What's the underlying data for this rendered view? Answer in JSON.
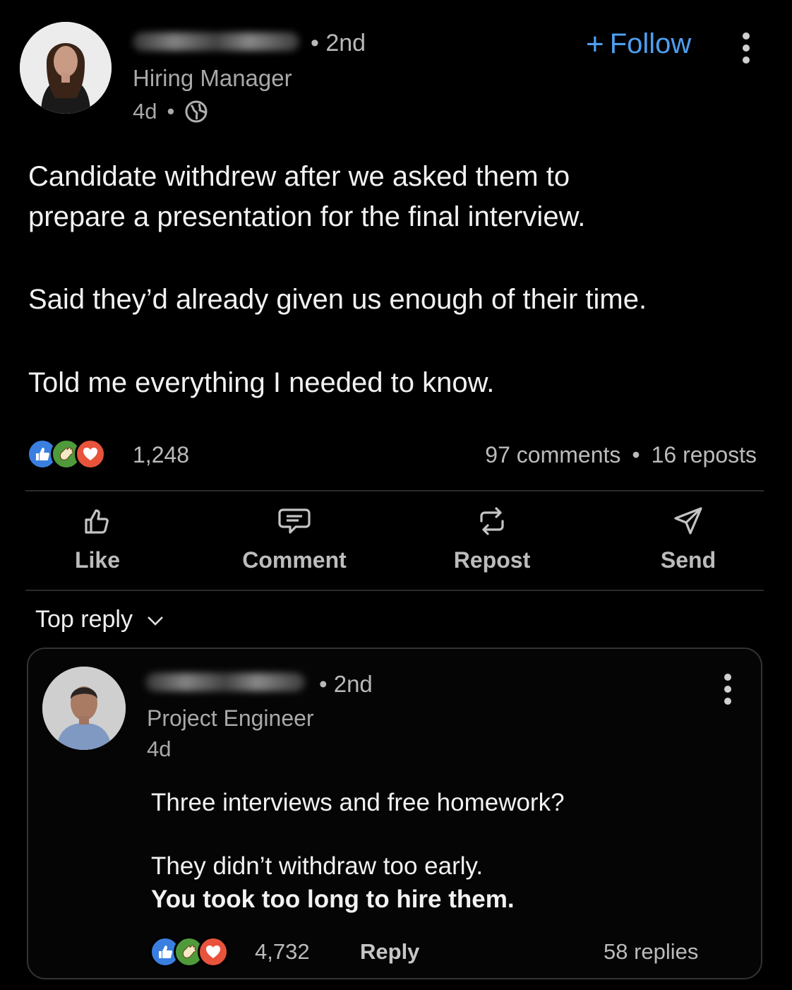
{
  "post": {
    "author_degree": "• 2nd",
    "author_title": "Hiring Manager",
    "time": "4d",
    "time_sep": "•",
    "follow_label": "Follow",
    "follow_plus": "+",
    "text_lines": [
      "Candidate withdrew after we asked them to",
      "prepare a presentation for the final interview.",
      "Said they’d already given us enough of their time.",
      "Told me everything I needed to know."
    ],
    "reaction_count": "1,248",
    "comments": "97 comments",
    "stats_sep": "•",
    "reposts": "16 reposts",
    "actions": {
      "like": "Like",
      "comment": "Comment",
      "repost": "Repost",
      "send": "Send"
    },
    "colors": {
      "accent": "#4f9ff0",
      "like": "#3a7fe0",
      "clap": "#4f9b3c",
      "love": "#e8533c"
    }
  },
  "sort": {
    "label": "Top reply"
  },
  "reply": {
    "author_degree": "• 2nd",
    "author_title": "Project Engineer",
    "time": "4d",
    "text_lines": [
      "Three interviews and free homework?",
      "They didn’t withdraw too early."
    ],
    "bold_line": "You took too long to hire them.",
    "reaction_count": "4,732",
    "reply_label": "Reply",
    "replies": "58 replies"
  }
}
